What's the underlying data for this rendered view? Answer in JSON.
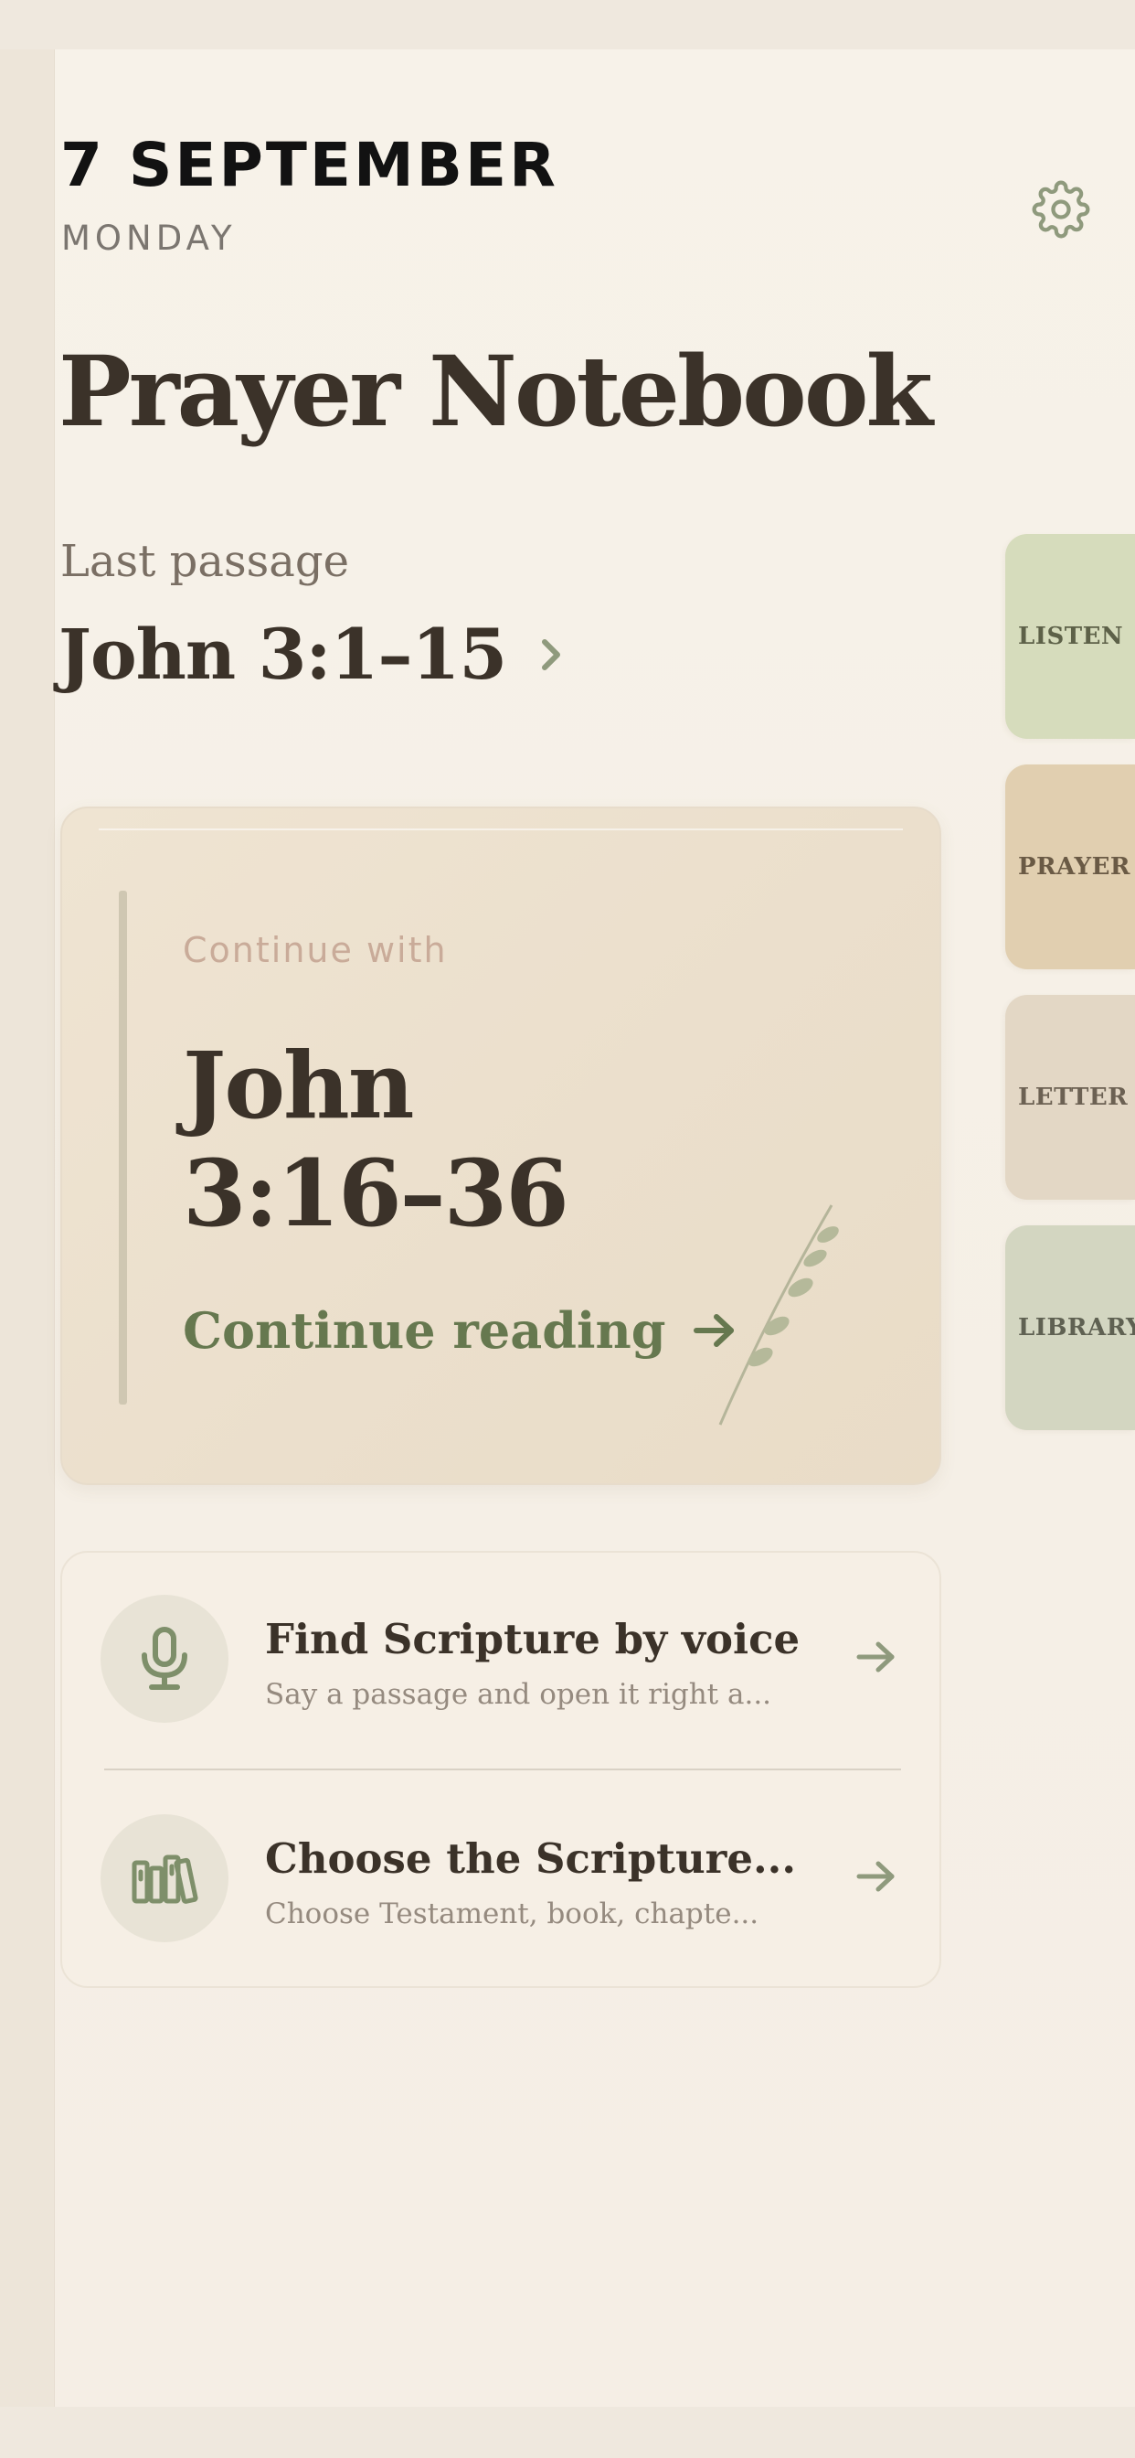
{
  "header": {
    "date": "7 SEPTEMBER",
    "weekday": "MONDAY",
    "settings_icon": "gear-icon"
  },
  "page_title": "Prayer Notebook",
  "last_passage": {
    "label": "Last passage",
    "reference": "John 3:1–15",
    "chevron_icon": "chevron-right-icon"
  },
  "continue_card": {
    "kicker": "Continue with",
    "book": "John",
    "verses": "3:16–36",
    "cta_label": "Continue reading",
    "arrow_icon": "arrow-right-icon",
    "decoration_icon": "olive-branch-icon"
  },
  "actions": [
    {
      "title": "Find Scripture by voice",
      "subtitle": "Say a passage and open it right a...",
      "icon": "microphone-icon"
    },
    {
      "title": "Choose the Scripture...",
      "subtitle": "Choose Testament, book, chapte...",
      "icon": "books-icon"
    }
  ],
  "side_tabs": [
    {
      "label": "LISTEN",
      "color": "#d6dcbc"
    },
    {
      "label": "PRAYER",
      "color": "#e1cfb0"
    },
    {
      "label": "LETTER",
      "color": "#e3d7c5"
    },
    {
      "label": "LIBRARY",
      "color": "#d3d6c1"
    }
  ],
  "colors": {
    "background": "#f5efe6",
    "text": "#3b3229",
    "accent_green": "#66784f",
    "icon_green": "#7e8f6a"
  }
}
